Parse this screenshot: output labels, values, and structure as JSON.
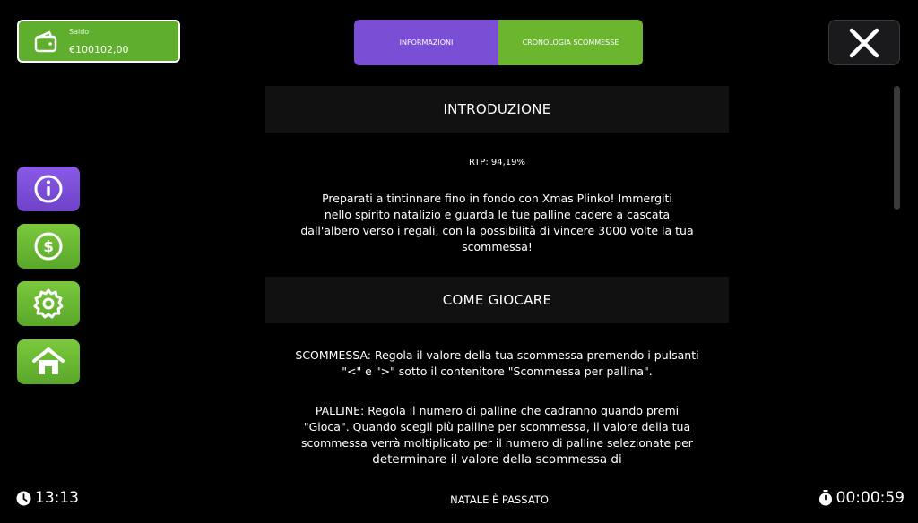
{
  "balance": {
    "label": "Saldo",
    "value": "€100102,00"
  },
  "tabs": {
    "info": "INFORMAZIONI",
    "history": "CRONOLOGIA SCOMMESSE"
  },
  "sidebar": [
    {
      "name": "info-icon"
    },
    {
      "name": "dollar-coin-icon"
    },
    {
      "name": "gear-icon"
    },
    {
      "name": "home-icon"
    }
  ],
  "content": {
    "intro_title": "INTRODUZIONE",
    "rtp": "RTP: 94,19%",
    "intro_lines": [
      "Preparati a tintinnare fino in fondo con Xmas Plinko! Immergiti",
      "nello spirito natalizio e guarda le tue palline cadere a cascata",
      "dall'albero verso i regali, con la possibilità di vincere 3000 volte la tua",
      "scommessa!"
    ],
    "how_title": "COME GIOCARE",
    "bet_lines": [
      "SCOMMESSA: Regola il valore della tua scommessa premendo i pulsanti",
      "\"<\" e \">\" sotto il contenitore \"Scommessa per pallina\"."
    ],
    "balls_lines": [
      "PALLINE: Regola il numero di palline che cadranno quando premi",
      "\"Gioca\". Quando scegli più palline per scommessa, il valore della tua",
      "scommessa verrà moltiplicato per il numero di palline selezionate per",
      "determinare il valore della scommessa di"
    ]
  },
  "footer": {
    "clock": "13:13",
    "title": "NATALE È PASSATO",
    "timer": "00:00:59"
  },
  "colors": {
    "purple": "#7a4fd6",
    "green": "#6bb52f",
    "background": "#000000"
  }
}
